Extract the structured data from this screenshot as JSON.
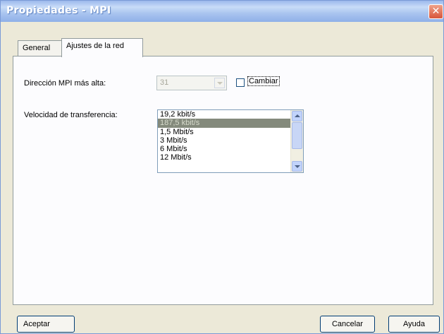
{
  "window": {
    "title": "Propiedades - MPI"
  },
  "tabs": [
    {
      "label": "General",
      "active": false
    },
    {
      "label": "Ajustes de la red",
      "active": true
    }
  ],
  "settings": {
    "mpi_label": "Dirección MPI más alta:",
    "mpi_value": "31",
    "change_label": "Cambiar",
    "change_checked": false,
    "speed_label": "Velocidad de transferencia:",
    "speeds": [
      "19,2 kbit/s",
      "187,5 kbit/s",
      "1,5 Mbit/s",
      "3 Mbit/s",
      "6 Mbit/s",
      "12 Mbit/s"
    ],
    "selected_speed": "187,5 kbit/s"
  },
  "buttons": {
    "accept": "Aceptar",
    "cancel": "Cancelar",
    "help": "Ayuda"
  },
  "icons": {
    "close": "close-icon"
  },
  "colors": {
    "selection": "#848a7c",
    "titlebar": "#9cb9ec",
    "close": "#d8553a"
  }
}
